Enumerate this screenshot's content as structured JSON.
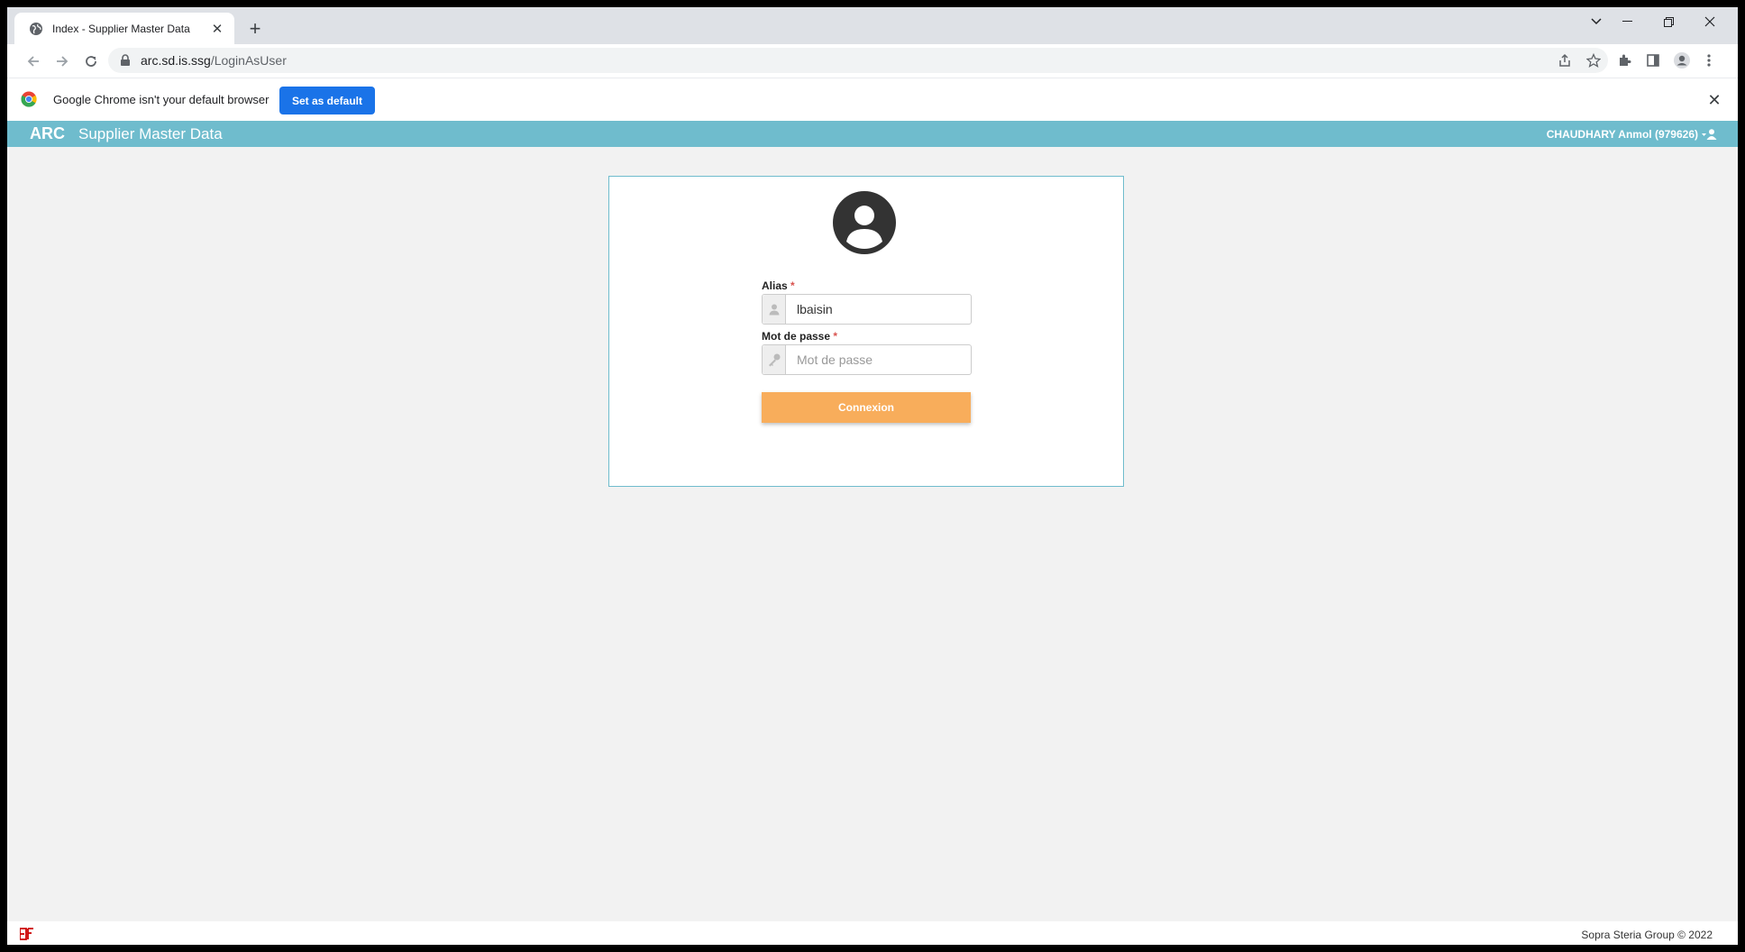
{
  "browser": {
    "tab_title": "Index - Supplier Master Data",
    "new_tab": "+",
    "url_host": "arc.sd.is.ssg",
    "url_path": "/LoginAsUser",
    "infobar_message": "Google Chrome isn't your default browser",
    "set_default_label": "Set as default"
  },
  "app": {
    "brand": "ARC",
    "title": "Supplier Master Data",
    "user": "CHAUDHARY Anmol (979626)",
    "accent_color": "#6fbccd"
  },
  "login": {
    "alias_label": "Alias",
    "alias_value": "lbaisin",
    "password_label": "Mot de passe",
    "password_placeholder": "Mot de passe",
    "required_mark": "*",
    "submit_label": "Connexion",
    "submit_color": "#f8ad5b"
  },
  "footer": {
    "copyright": "Sopra Steria Group © 2022"
  },
  "icons": {
    "tab": "globe-icon",
    "lock": "lock-icon",
    "user_field": "user-icon",
    "password_field": "key-icon",
    "avatar": "user-circle-icon"
  }
}
